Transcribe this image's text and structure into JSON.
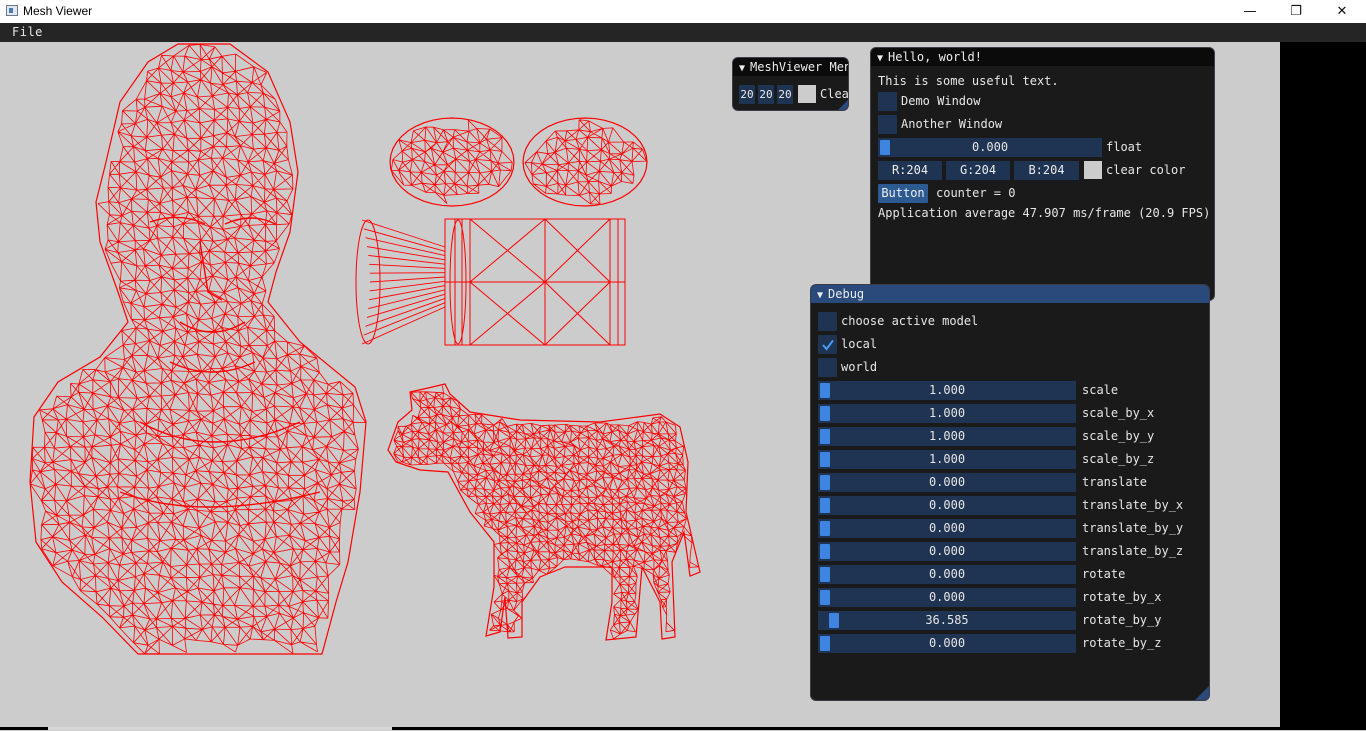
{
  "window": {
    "title": "Mesh Viewer",
    "icon": "app-icon",
    "controls": {
      "minimize": "—",
      "maximize": "❐",
      "close": "✕"
    }
  },
  "menubar": {
    "file": "File"
  },
  "viewport": {
    "background": "#cccccc",
    "wire_color": "#ff0000"
  },
  "meshviewer_menu": {
    "title": "MeshViewer Menu",
    "values": [
      "20",
      "20",
      "20"
    ],
    "clear_label": "Clear"
  },
  "hello": {
    "title": "Hello, world!",
    "text": "This is some useful text.",
    "demo_window": "Demo Window",
    "another_window": "Another Window",
    "float_value": "0.000",
    "float_fraction": 0.0,
    "float_label": "float",
    "r": "R:204",
    "g": "G:204",
    "b": "B:204",
    "clear_color_label": "clear color",
    "button_label": "Button",
    "counter": "counter = 0",
    "fps": "Application average 47.907 ms/frame (20.9 FPS)"
  },
  "debug": {
    "title": "Debug",
    "checkboxes": [
      {
        "label": "choose active model",
        "checked": false
      },
      {
        "label": "local",
        "checked": true
      },
      {
        "label": "world",
        "checked": false
      }
    ],
    "sliders": [
      {
        "label": "scale",
        "value": "1.000",
        "fraction": 0.0
      },
      {
        "label": "scale_by_x",
        "value": "1.000",
        "fraction": 0.0
      },
      {
        "label": "scale_by_y",
        "value": "1.000",
        "fraction": 0.0
      },
      {
        "label": "scale_by_z",
        "value": "1.000",
        "fraction": 0.0
      },
      {
        "label": "translate",
        "value": "0.000",
        "fraction": 0.0
      },
      {
        "label": "translate_by_x",
        "value": "0.000",
        "fraction": 0.0
      },
      {
        "label": "translate_by_y",
        "value": "0.000",
        "fraction": 0.0
      },
      {
        "label": "translate_by_z",
        "value": "0.000",
        "fraction": 0.0
      },
      {
        "label": "rotate",
        "value": "0.000",
        "fraction": 0.0
      },
      {
        "label": "rotate_by_x",
        "value": "0.000",
        "fraction": 0.0
      },
      {
        "label": "rotate_by_y",
        "value": "36.585",
        "fraction": 0.035
      },
      {
        "label": "rotate_by_z",
        "value": "0.000",
        "fraction": 0.0
      }
    ]
  }
}
